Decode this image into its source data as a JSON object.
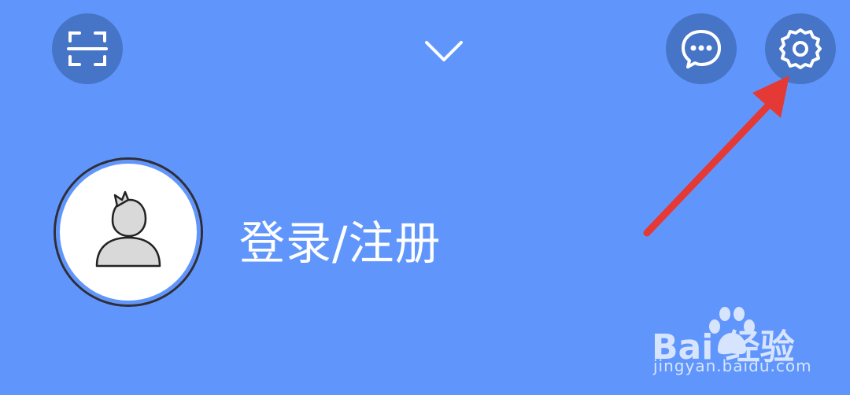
{
  "header": {
    "scan_icon": "scan-icon",
    "expand_icon": "chevron-down-icon",
    "message_icon": "message-bubble-icon",
    "settings_icon": "gear-icon"
  },
  "profile": {
    "avatar_icon": "default-user-avatar-icon",
    "login_label": "登录/注册"
  },
  "watermark": {
    "brand": "Bai    经验",
    "url": "jingyan.baidu.com"
  },
  "colors": {
    "background": "#6096fc",
    "button_bg": "#4674c6",
    "annotation_arrow": "#e53935",
    "text": "#ffffff"
  }
}
